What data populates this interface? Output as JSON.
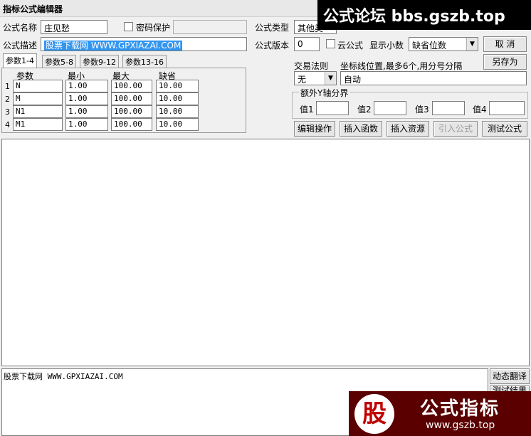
{
  "window": {
    "title": "指标公式编辑器"
  },
  "form": {
    "name_label": "公式名称",
    "name_value": "庄见愁",
    "password_label": "密码保护",
    "desc_label": "公式描述",
    "desc_value": "股票下载网 WWW.GPXIAZAI.COM",
    "type_label": "公式类型",
    "type_value": "其他类",
    "version_label": "公式版本",
    "version_value": "0",
    "cloud_label": "云公式",
    "decimals_label": "显示小数",
    "decimals_value": "缺省位数",
    "trade_rule_label": "交易法则",
    "trade_rule_value": "无",
    "coord_label": "坐标线位置,最多6个,用分号分隔",
    "coord_value": "自动",
    "extra_y_label": "额外Y轴分界",
    "val_labels": [
      "值1",
      "值2",
      "值3",
      "值4"
    ]
  },
  "buttons": {
    "cancel": "取 消",
    "save_as": "另存为",
    "edit_ops": "编辑操作",
    "insert_func": "插入函数",
    "insert_res": "插入资源",
    "import_formula": "引入公式",
    "test_formula": "测试公式",
    "dynamic_translate": "动态翻译",
    "test_result": "测试结果"
  },
  "tabs": [
    "参数1-4",
    "参数5-8",
    "参数9-12",
    "参数13-16"
  ],
  "params": {
    "headers": [
      "参数",
      "最小",
      "最大",
      "缺省"
    ],
    "rows": [
      {
        "n": "1",
        "name": "N",
        "min": "1.00",
        "max": "100.00",
        "def": "10.00"
      },
      {
        "n": "2",
        "name": "M",
        "min": "1.00",
        "max": "100.00",
        "def": "10.00"
      },
      {
        "n": "3",
        "name": "N1",
        "min": "1.00",
        "max": "100.00",
        "def": "10.00"
      },
      {
        "n": "4",
        "name": "M1",
        "min": "1.00",
        "max": "100.00",
        "def": "10.00"
      }
    ]
  },
  "output_text": "股票下载网 WWW.GPXIAZAI.COM",
  "watermarks": {
    "top": "公式论坛 bbs.gszb.top",
    "bottom_logo": "股",
    "bottom_title": "公式指标",
    "bottom_url": "www.gszb.top"
  },
  "colors": {
    "keyword": "#0000c0",
    "func": "#008000",
    "number": "#c08000",
    "var": "#000080",
    "comment": "#808080",
    "const": "#800080"
  }
}
